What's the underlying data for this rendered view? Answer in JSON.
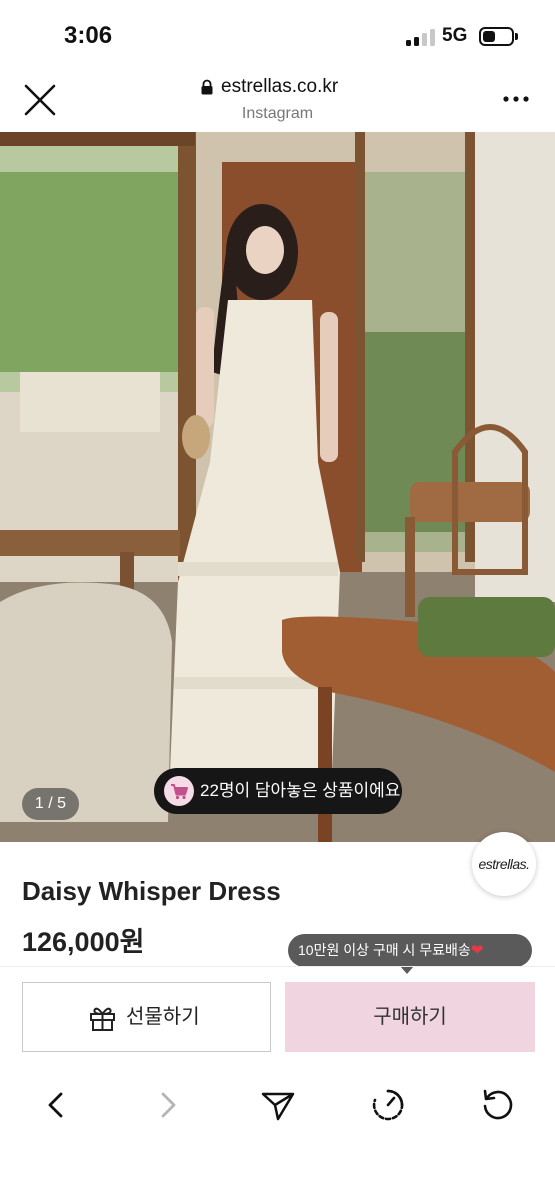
{
  "status_bar": {
    "time": "3:06",
    "network": "5G"
  },
  "browser": {
    "url": "estrellas.co.kr",
    "subtitle": "Instagram"
  },
  "photo": {
    "counter": "1 / 5",
    "saved_notice": "22명이 담아놓은 상품이에요"
  },
  "brand": {
    "logo_text": "estrellas."
  },
  "product": {
    "name": "Daisy Whisper Dress",
    "price": "126,000원"
  },
  "promo": {
    "shipping_tip": "10만원 이상 구매 시 무료배송",
    "heart": "❤"
  },
  "actions": {
    "gift_label": "선물하기",
    "buy_label": "구매하기"
  },
  "toolbar_icons": [
    "back-icon",
    "forward-icon",
    "send-icon",
    "history-icon",
    "reload-icon"
  ],
  "colors": {
    "buy_button": "#f0d5e0",
    "tooltip": "#5a5a5a",
    "pill": "#161616",
    "heart": "#e53946"
  }
}
